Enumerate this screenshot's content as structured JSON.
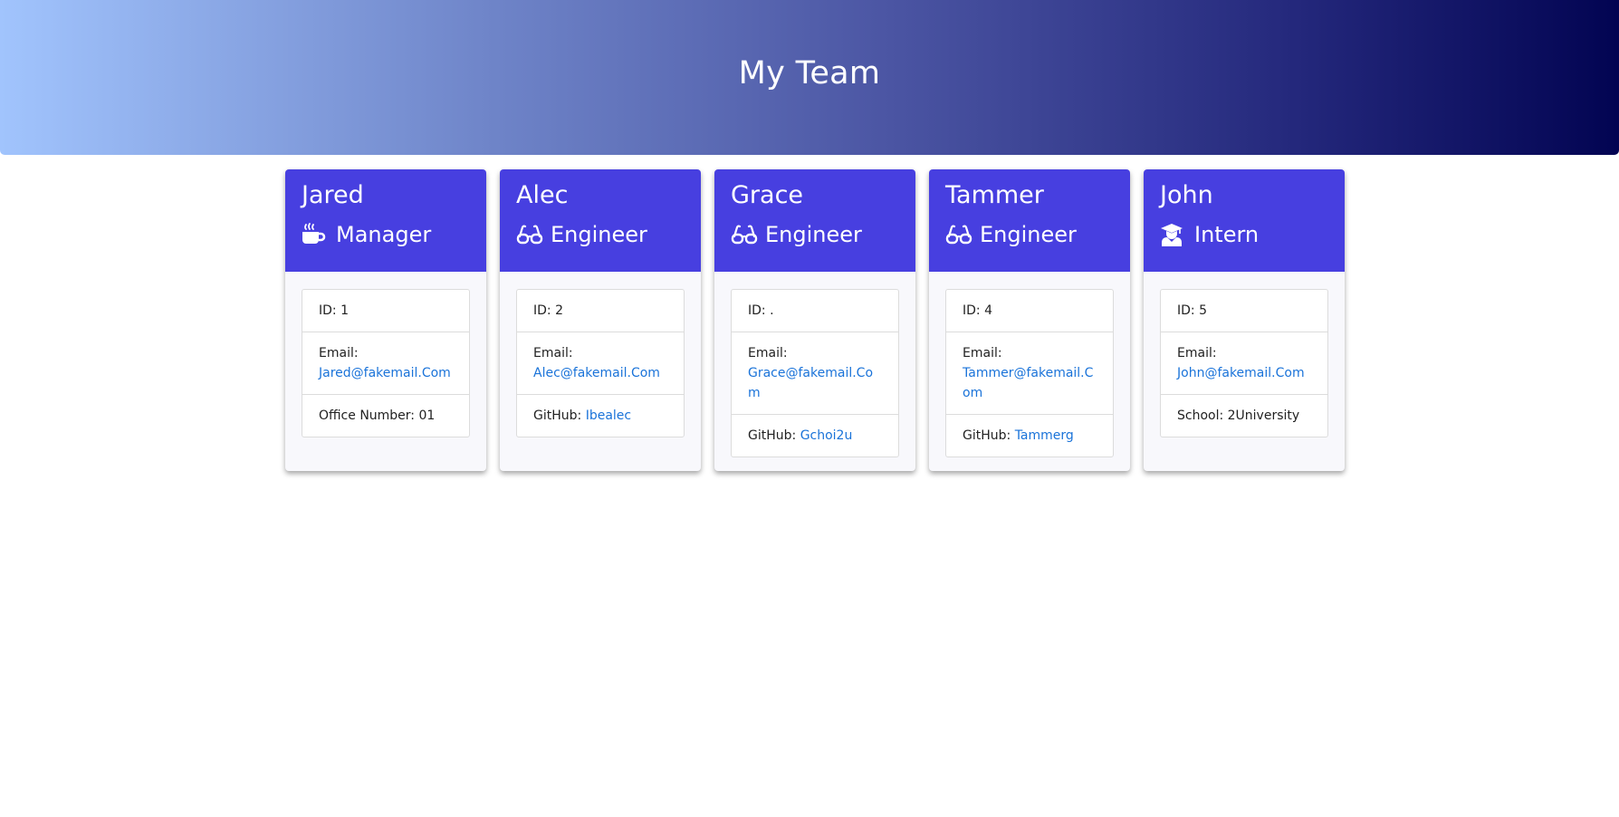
{
  "header": {
    "title": "My Team"
  },
  "employees": [
    {
      "name": "Jared",
      "role": "Manager",
      "icon": "coffee-icon",
      "id_label": "ID: 1",
      "email_label": "Email:",
      "email": "Jared@fakemail.Com",
      "extra_label": "Office Number: 01",
      "extra_link": ""
    },
    {
      "name": "Alec",
      "role": "Engineer",
      "icon": "glasses-icon",
      "id_label": "ID: 2",
      "email_label": "Email:",
      "email": "Alec@fakemail.Com",
      "extra_label": "GitHub: ",
      "extra_link": "Ibealec"
    },
    {
      "name": "Grace",
      "role": "Engineer",
      "icon": "glasses-icon",
      "id_label": "ID: .",
      "email_label": "Email:",
      "email": "Grace@fakemail.Com",
      "extra_label": "GitHub: ",
      "extra_link": "Gchoi2u"
    },
    {
      "name": "Tammer",
      "role": "Engineer",
      "icon": "glasses-icon",
      "id_label": "ID: 4",
      "email_label": "Email:",
      "email": "Tammer@fakemail.Com",
      "extra_label": "GitHub: ",
      "extra_link": "Tammerg"
    },
    {
      "name": "John",
      "role": "Intern",
      "icon": "graduate-icon",
      "id_label": "ID: 5",
      "email_label": "Email:",
      "email": "John@fakemail.Com",
      "extra_label": "School: 2University",
      "extra_link": ""
    }
  ],
  "colors": {
    "card_header": "#473fe0",
    "link": "#1a73d9",
    "gradient_start": "#a1c4fd",
    "gradient_end": "#020452"
  }
}
